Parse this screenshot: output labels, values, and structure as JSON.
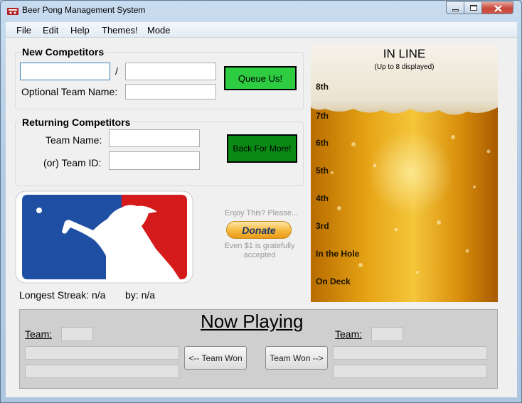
{
  "window": {
    "title": "Beer Pong Management System",
    "controls": [
      "minimize-icon",
      "maximize-icon",
      "close-icon"
    ]
  },
  "menu": [
    "File",
    "Edit",
    "Help",
    "Themes!",
    "Mode"
  ],
  "new_competitors": {
    "title": "New Competitors",
    "separator": "/",
    "player1_value": "",
    "player2_value": "",
    "team_label": "Optional Team Name:",
    "team_value": "",
    "queue_button": "Queue Us!"
  },
  "returning": {
    "title": "Returning Competitors",
    "team_name_label": "Team Name:",
    "team_name_value": "",
    "team_id_label": "(or) Team ID:",
    "team_id_value": "",
    "back_button": "Back For More!"
  },
  "streak": {
    "longest_label": "Longest Streak: n/a",
    "by_label": "by: n/a"
  },
  "donate": {
    "prompt": "Enjoy This? Please...",
    "button": "Donate",
    "note": "Even $1 is gratefully accepted"
  },
  "queue": {
    "title": "IN LINE",
    "subtitle": "(Up to 8 displayed)",
    "slots": [
      "8th",
      "7th",
      "6th",
      "5th",
      "4th",
      "3rd",
      "In the Hole",
      "On Deck"
    ]
  },
  "now_playing": {
    "title": "Now Playing",
    "team_left_label": "Team:",
    "team_right_label": "Team:",
    "left_won_button": "<-- Team Won",
    "right_won_button": "Team Won -->"
  },
  "colors": {
    "queue_button_bg": "#2ecc40",
    "back_button_bg": "#0a8a14",
    "logo_blue": "#1f4fa3",
    "logo_red": "#d41a1a",
    "donate_bg": "#f6b73c"
  }
}
